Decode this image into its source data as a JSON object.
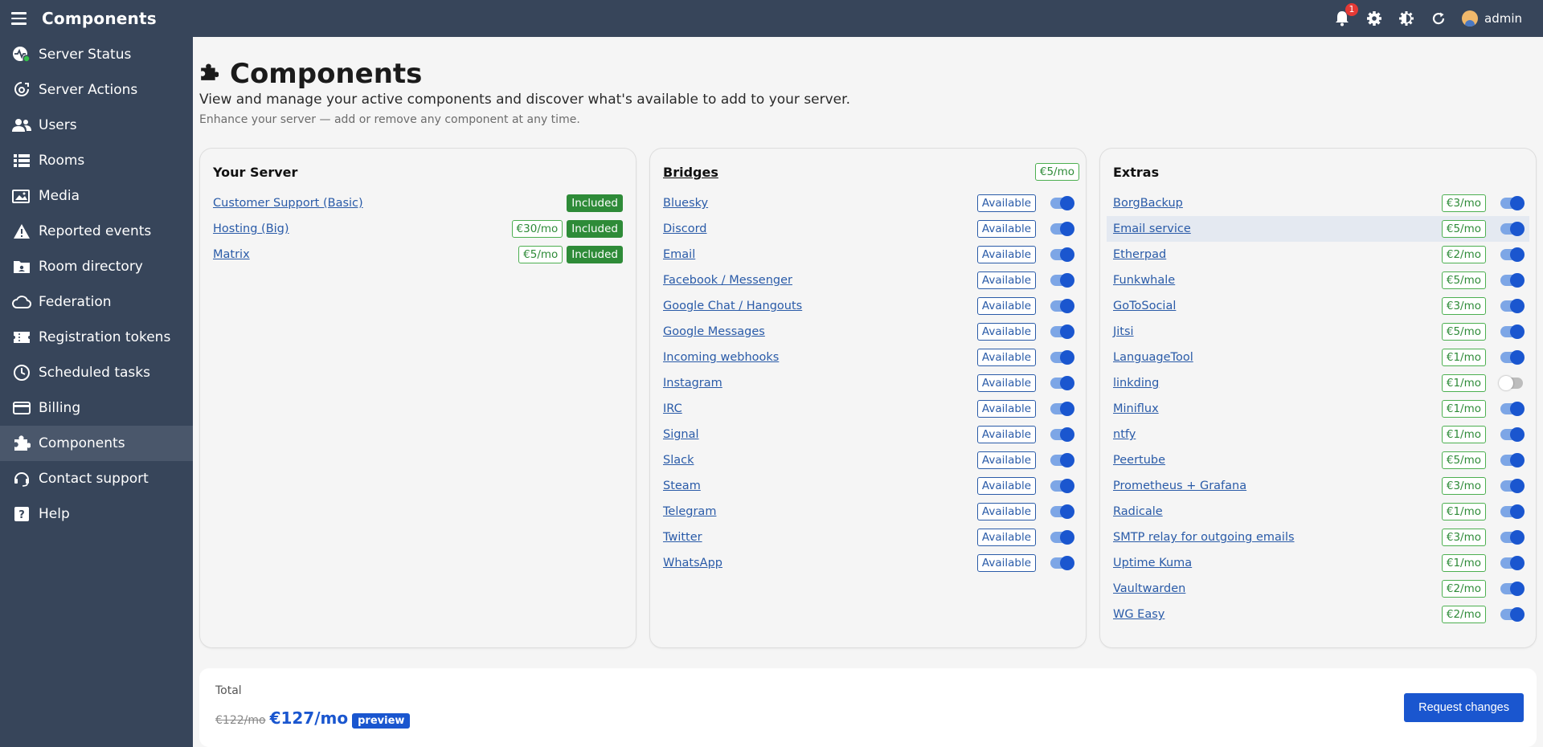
{
  "header": {
    "title": "Components",
    "notification_count": "1",
    "user": "admin"
  },
  "sidebar": {
    "items": [
      {
        "label": "Server Status",
        "icon": "server-status-icon"
      },
      {
        "label": "Server Actions",
        "icon": "server-actions-icon"
      },
      {
        "label": "Users",
        "icon": "users-icon"
      },
      {
        "label": "Rooms",
        "icon": "rooms-icon"
      },
      {
        "label": "Media",
        "icon": "media-icon"
      },
      {
        "label": "Reported events",
        "icon": "warning-icon"
      },
      {
        "label": "Room directory",
        "icon": "folder-icon"
      },
      {
        "label": "Federation",
        "icon": "cloud-icon"
      },
      {
        "label": "Registration tokens",
        "icon": "ticket-icon"
      },
      {
        "label": "Scheduled tasks",
        "icon": "clock-icon"
      },
      {
        "label": "Billing",
        "icon": "card-icon"
      },
      {
        "label": "Components",
        "icon": "puzzle-icon"
      },
      {
        "label": "Contact support",
        "icon": "headset-icon"
      },
      {
        "label": "Help",
        "icon": "help-icon"
      }
    ]
  },
  "page": {
    "title": "Components",
    "description": "View and manage your active components and discover what's available to add to your server.",
    "subtitle": "Enhance your server — add or remove any component at any time."
  },
  "your_server": {
    "title": "Your Server",
    "items": [
      {
        "name": "Customer Support (Basic)",
        "price": "",
        "status": "Included"
      },
      {
        "name": "Hosting (Big)",
        "price": "€30/mo",
        "status": "Included"
      },
      {
        "name": "Matrix",
        "price": "€5/mo",
        "status": "Included"
      }
    ]
  },
  "bridges": {
    "title": "Bridges",
    "price": "€5/mo",
    "items": [
      {
        "name": "Bluesky",
        "status": "Available",
        "enabled": true
      },
      {
        "name": "Discord",
        "status": "Available",
        "enabled": true
      },
      {
        "name": "Email",
        "status": "Available",
        "enabled": true
      },
      {
        "name": "Facebook / Messenger",
        "status": "Available",
        "enabled": true
      },
      {
        "name": "Google Chat / Hangouts",
        "status": "Available",
        "enabled": true
      },
      {
        "name": "Google Messages",
        "status": "Available",
        "enabled": true
      },
      {
        "name": "Incoming webhooks",
        "status": "Available",
        "enabled": true
      },
      {
        "name": "Instagram",
        "status": "Available",
        "enabled": true
      },
      {
        "name": "IRC",
        "status": "Available",
        "enabled": true
      },
      {
        "name": "Signal",
        "status": "Available",
        "enabled": true
      },
      {
        "name": "Slack",
        "status": "Available",
        "enabled": true
      },
      {
        "name": "Steam",
        "status": "Available",
        "enabled": true
      },
      {
        "name": "Telegram",
        "status": "Available",
        "enabled": true
      },
      {
        "name": "Twitter",
        "status": "Available",
        "enabled": true
      },
      {
        "name": "WhatsApp",
        "status": "Available",
        "enabled": true
      }
    ]
  },
  "extras": {
    "title": "Extras",
    "items": [
      {
        "name": "BorgBackup",
        "price": "€3/mo",
        "enabled": true
      },
      {
        "name": "Email service",
        "price": "€5/mo",
        "enabled": true,
        "highlighted": true
      },
      {
        "name": "Etherpad",
        "price": "€2/mo",
        "enabled": true
      },
      {
        "name": "Funkwhale",
        "price": "€5/mo",
        "enabled": true
      },
      {
        "name": "GoToSocial",
        "price": "€3/mo",
        "enabled": true
      },
      {
        "name": "Jitsi",
        "price": "€5/mo",
        "enabled": true
      },
      {
        "name": "LanguageTool",
        "price": "€1/mo",
        "enabled": true
      },
      {
        "name": "linkding",
        "price": "€1/mo",
        "enabled": false
      },
      {
        "name": "Miniflux",
        "price": "€1/mo",
        "enabled": true
      },
      {
        "name": "ntfy",
        "price": "€1/mo",
        "enabled": true
      },
      {
        "name": "Peertube",
        "price": "€5/mo",
        "enabled": true
      },
      {
        "name": "Prometheus + Grafana",
        "price": "€3/mo",
        "enabled": true
      },
      {
        "name": "Radicale",
        "price": "€1/mo",
        "enabled": true
      },
      {
        "name": "SMTP relay for outgoing emails",
        "price": "€3/mo",
        "enabled": true
      },
      {
        "name": "Uptime Kuma",
        "price": "€1/mo",
        "enabled": true
      },
      {
        "name": "Vaultwarden",
        "price": "€2/mo",
        "enabled": true
      },
      {
        "name": "WG Easy",
        "price": "€2/mo",
        "enabled": true
      }
    ]
  },
  "total": {
    "label": "Total",
    "old_price": "€122/mo",
    "new_price": "€127/mo",
    "preview_label": "preview",
    "button_label": "Request changes"
  },
  "colors": {
    "sidebar": "#37455a",
    "accent": "#1a56cf",
    "included": "#2e8b38",
    "link": "#2a5ba8"
  }
}
